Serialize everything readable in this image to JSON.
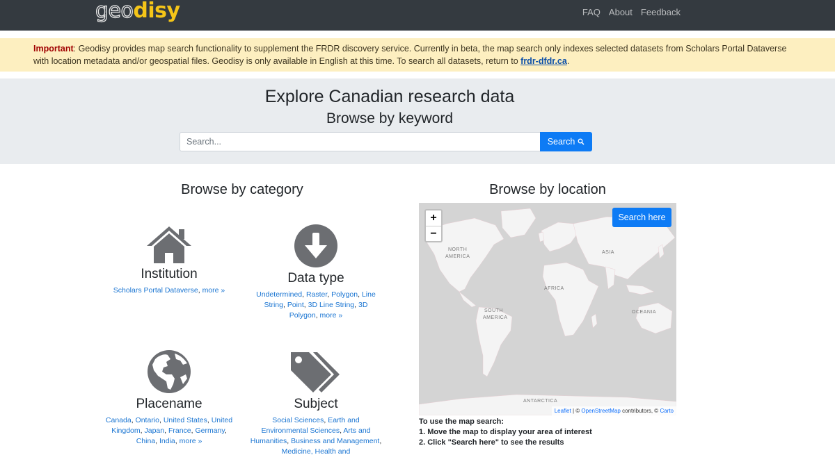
{
  "navbar": {
    "logo_part1": "geo",
    "logo_part2": "disy",
    "links": [
      "FAQ",
      "About",
      "Feedback"
    ]
  },
  "alert": {
    "label": "Important",
    "text": ": Geodisy provides map search functionality to supplement the FRDR discovery service. Currently in beta, the map search only indexes selected datasets from Scholars Portal Dataverse with location metadata and/or geospatial files. Geodisy is only available in English at this time. To search all datasets, return to ",
    "link": "frdr-dfdr.ca",
    "end": "."
  },
  "hero": {
    "title": "Explore Canadian research data",
    "subtitle": "Browse by keyword",
    "search_placeholder": "Search...",
    "search_button": "Search"
  },
  "category": {
    "heading": "Browse by category",
    "institution": {
      "title": "Institution",
      "links": [
        "Scholars Portal Dataverse"
      ],
      "more": "more »"
    },
    "datatype": {
      "title": "Data type",
      "links": [
        "Undetermined",
        "Raster",
        "Polygon",
        "Line String",
        "Point",
        "3D Line String",
        "3D Polygon"
      ],
      "more": "more »"
    },
    "placename": {
      "title": "Placename",
      "links": [
        "Canada",
        "Ontario",
        "United States",
        "United Kingdom",
        "Japan",
        "France",
        "Germany",
        "China",
        "India"
      ],
      "more": "more »"
    },
    "subject": {
      "title": "Subject",
      "links": [
        "Social Sciences",
        "Earth and Environmental Sciences",
        "Arts and Humanities",
        "Business and Management",
        "Medicine, Health and"
      ]
    }
  },
  "location": {
    "heading": "Browse by location",
    "search_here": "Search here",
    "zoom_in": "+",
    "zoom_out": "−",
    "labels": {
      "na1": "NORTH",
      "na2": "AMERICA",
      "asia": "ASIA",
      "africa": "AFRICA",
      "sa1": "SOUTH",
      "sa2": "AMERICA",
      "oceania": "OCEANIA",
      "antarctica": "ANTARCTICA"
    },
    "attribution": {
      "leaflet": "Leaflet",
      "sep1": " | © ",
      "osm": "OpenStreetMap",
      "sep2": " contributors, © ",
      "carto": "Carto"
    },
    "instructions": [
      "To use the map search:",
      "1. Move the map to display your area of interest",
      "2. Click \"Search here\" to see the results"
    ]
  },
  "colors": {
    "navbar": "#343a40",
    "alert_bg": "#fdefc0",
    "hero_bg": "#e9ecef",
    "primary": "#0d7bf5",
    "icon_gray": "#6c6e72",
    "logo_yellow": "#f5c518"
  }
}
